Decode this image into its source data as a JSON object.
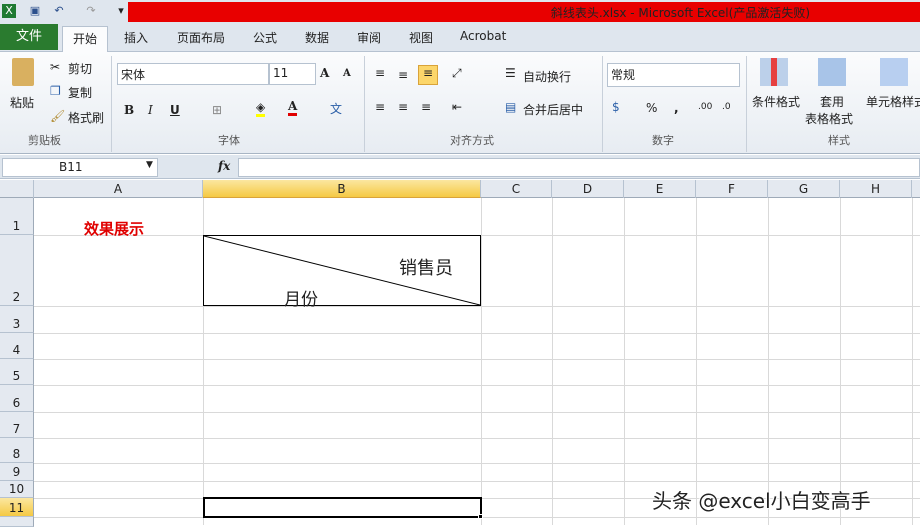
{
  "window": {
    "title": "斜线表头.xlsx - Microsoft Excel(产品激活失败)"
  },
  "tabs": [
    "文件",
    "开始",
    "插入",
    "页面布局",
    "公式",
    "数据",
    "审阅",
    "视图",
    "Acrobat"
  ],
  "clipboard": {
    "paste": "粘贴",
    "cut": "剪切",
    "copy": "复制",
    "format_painter": "格式刷",
    "group": "剪贴板"
  },
  "font": {
    "name": "宋体",
    "size": "11",
    "group": "字体",
    "bold": "B",
    "italic": "I",
    "underline": "U"
  },
  "alignment": {
    "wrap": "自动换行",
    "merge": "合并后居中",
    "group": "对齐方式"
  },
  "number": {
    "format": "常规",
    "percent": "%",
    "comma": ",",
    "group": "数字"
  },
  "styles": {
    "conditional": "条件格式",
    "table1": "套用",
    "table2": "表格格式",
    "cell": "单元格样式",
    "group": "样式"
  },
  "formula_bar": {
    "name_box": "B11",
    "fx": "fx",
    "value": ""
  },
  "columns": [
    "A",
    "B",
    "C",
    "D",
    "E",
    "F",
    "G",
    "H"
  ],
  "rows": [
    "1",
    "2",
    "3",
    "4",
    "5",
    "6",
    "7",
    "8",
    "9",
    "10",
    "11"
  ],
  "cells": {
    "A1": "效果展示",
    "B2_top": "销售员",
    "B2_bottom": "月份"
  },
  "watermark": "头条 @excel小白变高手",
  "colors": {
    "accent_red": "#e80000",
    "file_tab": "#2a7b2f",
    "selected_header": "#f7d86a"
  }
}
